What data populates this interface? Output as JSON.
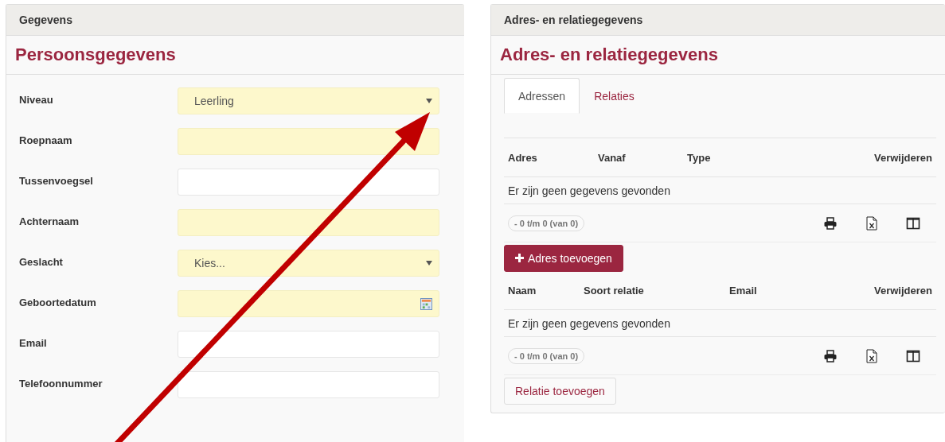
{
  "left_panel": {
    "header": "Gegevens",
    "title": "Persoonsgegevens",
    "fields": [
      {
        "label": "Niveau",
        "kind": "select",
        "required": true,
        "value": "Leerling"
      },
      {
        "label": "Roepnaam",
        "kind": "text",
        "required": true
      },
      {
        "label": "Tussenvoegsel",
        "kind": "text",
        "required": false
      },
      {
        "label": "Achternaam",
        "kind": "text",
        "required": true
      },
      {
        "label": "Geslacht",
        "kind": "select",
        "required": true,
        "value": "Kies..."
      },
      {
        "label": "Geboortedatum",
        "kind": "date",
        "required": true
      },
      {
        "label": "Email",
        "kind": "text",
        "required": false
      },
      {
        "label": "Telefoonnummer",
        "kind": "text",
        "required": false
      }
    ]
  },
  "right_panel": {
    "header": "Adres- en relatiegegevens",
    "title": "Adres- en relatiegegevens",
    "tabs": [
      {
        "label": "Adressen",
        "selected": true
      },
      {
        "label": "Relaties",
        "selected": false
      }
    ],
    "tables": [
      {
        "columns": [
          "Adres",
          "Vanaf",
          "Type",
          "Verwijderen"
        ],
        "empty_text": "Er zijn geen gegevens gevonden",
        "pager": "- 0 t/m 0 (van 0)",
        "button": {
          "label": "Adres toevoegen",
          "kind": "primary"
        }
      },
      {
        "columns": [
          "Naam",
          "Soort relatie",
          "Email",
          "Verwijderen"
        ],
        "empty_text": "Er zijn geen gegevens gevonden",
        "pager": "- 0 t/m 0 (van 0)",
        "button": {
          "label": "Relatie toevoegen",
          "kind": "secondary"
        }
      }
    ]
  }
}
